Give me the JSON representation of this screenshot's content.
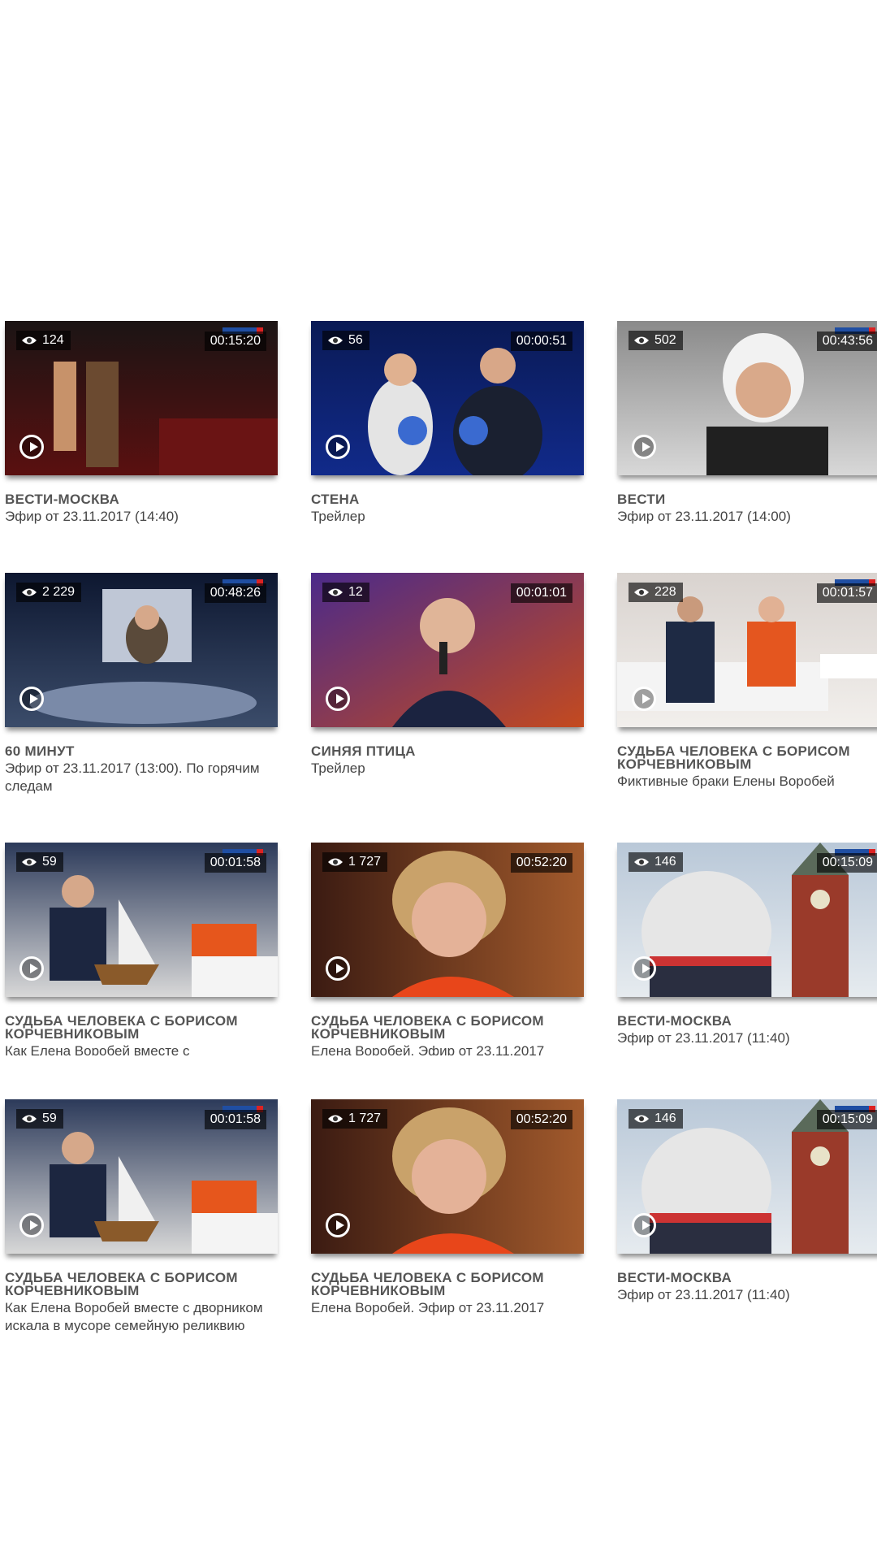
{
  "rows": [
    [
      {
        "views": "124",
        "duration": "00:15:20",
        "title": "ВЕСТИ-МОСКВА",
        "subtitle": "Эфир от 23.11.2017 (14:40)"
      },
      {
        "views": "56",
        "duration": "00:00:51",
        "title": "СТЕНА",
        "subtitle": "Трейлер"
      },
      {
        "views": "502",
        "duration": "00:43:56",
        "title": "ВЕСТИ",
        "subtitle": "Эфир от 23.11.2017 (14:00)"
      }
    ],
    [
      {
        "views": "2 229",
        "duration": "00:48:26",
        "title": "60 МИНУТ",
        "subtitle": "Эфир от 23.11.2017 (13:00). По горячим следам"
      },
      {
        "views": "12",
        "duration": "00:01:01",
        "title": "СИНЯЯ ПТИЦА",
        "subtitle": "Трейлер"
      },
      {
        "views": "228",
        "duration": "00:01:57",
        "title": "СУДЬБА ЧЕЛОВЕКА С БОРИСОМ КОРЧЕВНИКОВЫМ",
        "subtitle": "Фиктивные браки Елены Воробей"
      }
    ],
    [
      {
        "views": "59",
        "duration": "00:01:58",
        "title": "СУДЬБА ЧЕЛОВЕКА С БОРИСОМ КОРЧЕВНИКОВЫМ",
        "subtitle": "Как Елена Воробей вместе с"
      },
      {
        "views": "1 727",
        "duration": "00:52:20",
        "title": "СУДЬБА ЧЕЛОВЕКА С БОРИСОМ КОРЧЕВНИКОВЫМ",
        "subtitle": "Елена Воробей. Эфир от 23.11.2017"
      },
      {
        "views": "146",
        "duration": "00:15:09",
        "title": "ВЕСТИ-МОСКВА",
        "subtitle": "Эфир от 23.11.2017 (11:40)"
      }
    ],
    [
      {
        "views": "59",
        "duration": "00:01:58",
        "title": "СУДЬБА ЧЕЛОВЕКА С БОРИСОМ КОРЧЕВНИКОВЫМ",
        "subtitle": "Как Елена Воробей вместе с дворником искала в мусоре семейную реликвию"
      },
      {
        "views": "1 727",
        "duration": "00:52:20",
        "title": "СУДЬБА ЧЕЛОВЕКА С БОРИСОМ КОРЧЕВНИКОВЫМ",
        "subtitle": "Елена Воробей. Эфир от 23.11.2017"
      },
      {
        "views": "146",
        "duration": "00:15:09",
        "title": "ВЕСТИ-МОСКВА",
        "subtitle": "Эфир от 23.11.2017 (11:40)"
      }
    ]
  ],
  "icons": {
    "views": "eye-icon",
    "play": "play-icon",
    "channel": "channel-logo"
  },
  "colors": {
    "title": "#555555",
    "subtitle": "#444444",
    "badge": "#000000"
  }
}
